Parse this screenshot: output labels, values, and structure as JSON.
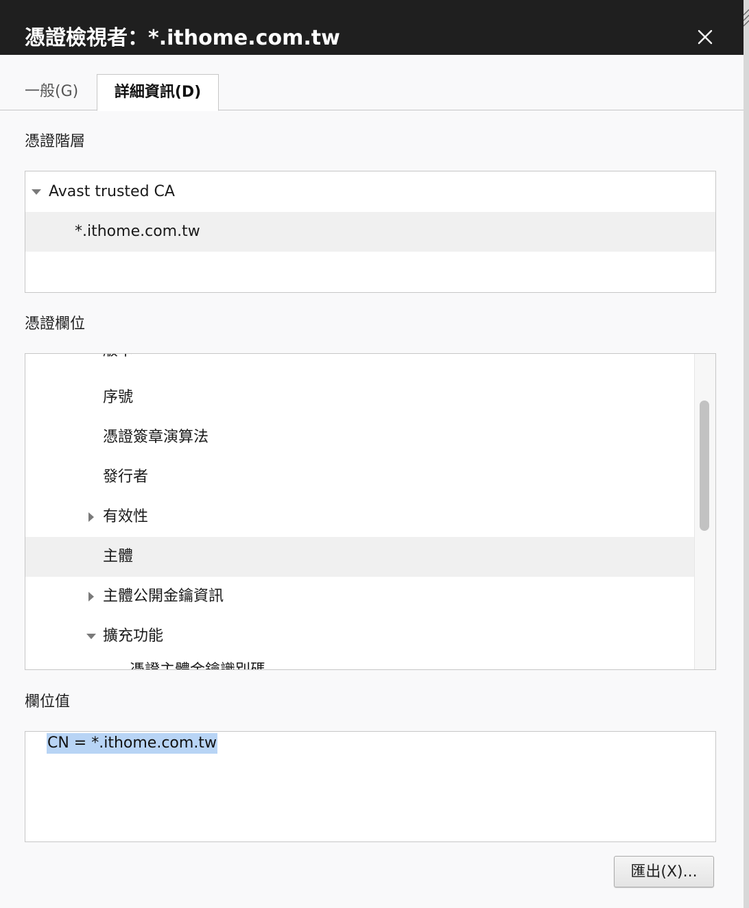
{
  "window": {
    "title": "憑證檢視者：*.ithome.com.tw",
    "close_icon": "close-icon"
  },
  "tabs": [
    {
      "label": "一般(G)",
      "active": false
    },
    {
      "label": "詳細資訊(D)",
      "active": true
    }
  ],
  "hierarchy": {
    "label": "憑證階層",
    "items": [
      {
        "label": "Avast trusted CA",
        "expanded": true,
        "selected": false
      },
      {
        "label": "*.ithome.com.tw",
        "selected": true
      }
    ]
  },
  "fields": {
    "label": "憑證欄位",
    "items": [
      {
        "label": "版本"
      },
      {
        "label": "序號"
      },
      {
        "label": "憑證簽章演算法"
      },
      {
        "label": "發行者"
      },
      {
        "label": "有效性",
        "twisty": "collapsed"
      },
      {
        "label": "主體",
        "selected": true
      },
      {
        "label": "主體公開金鑰資訊",
        "twisty": "collapsed"
      },
      {
        "label": "擴充功能",
        "twisty": "expanded"
      },
      {
        "label": "憑證主體金鑰識別碼"
      }
    ]
  },
  "field_value": {
    "label": "欄位值",
    "value": "CN = *.ithome.com.tw"
  },
  "buttons": {
    "export_label": "匯出(X)..."
  },
  "colors": {
    "titlebar_bg": "#1f1f1f",
    "selection_bg": "#f0f0f0",
    "text_highlight": "#b8d4f5"
  }
}
